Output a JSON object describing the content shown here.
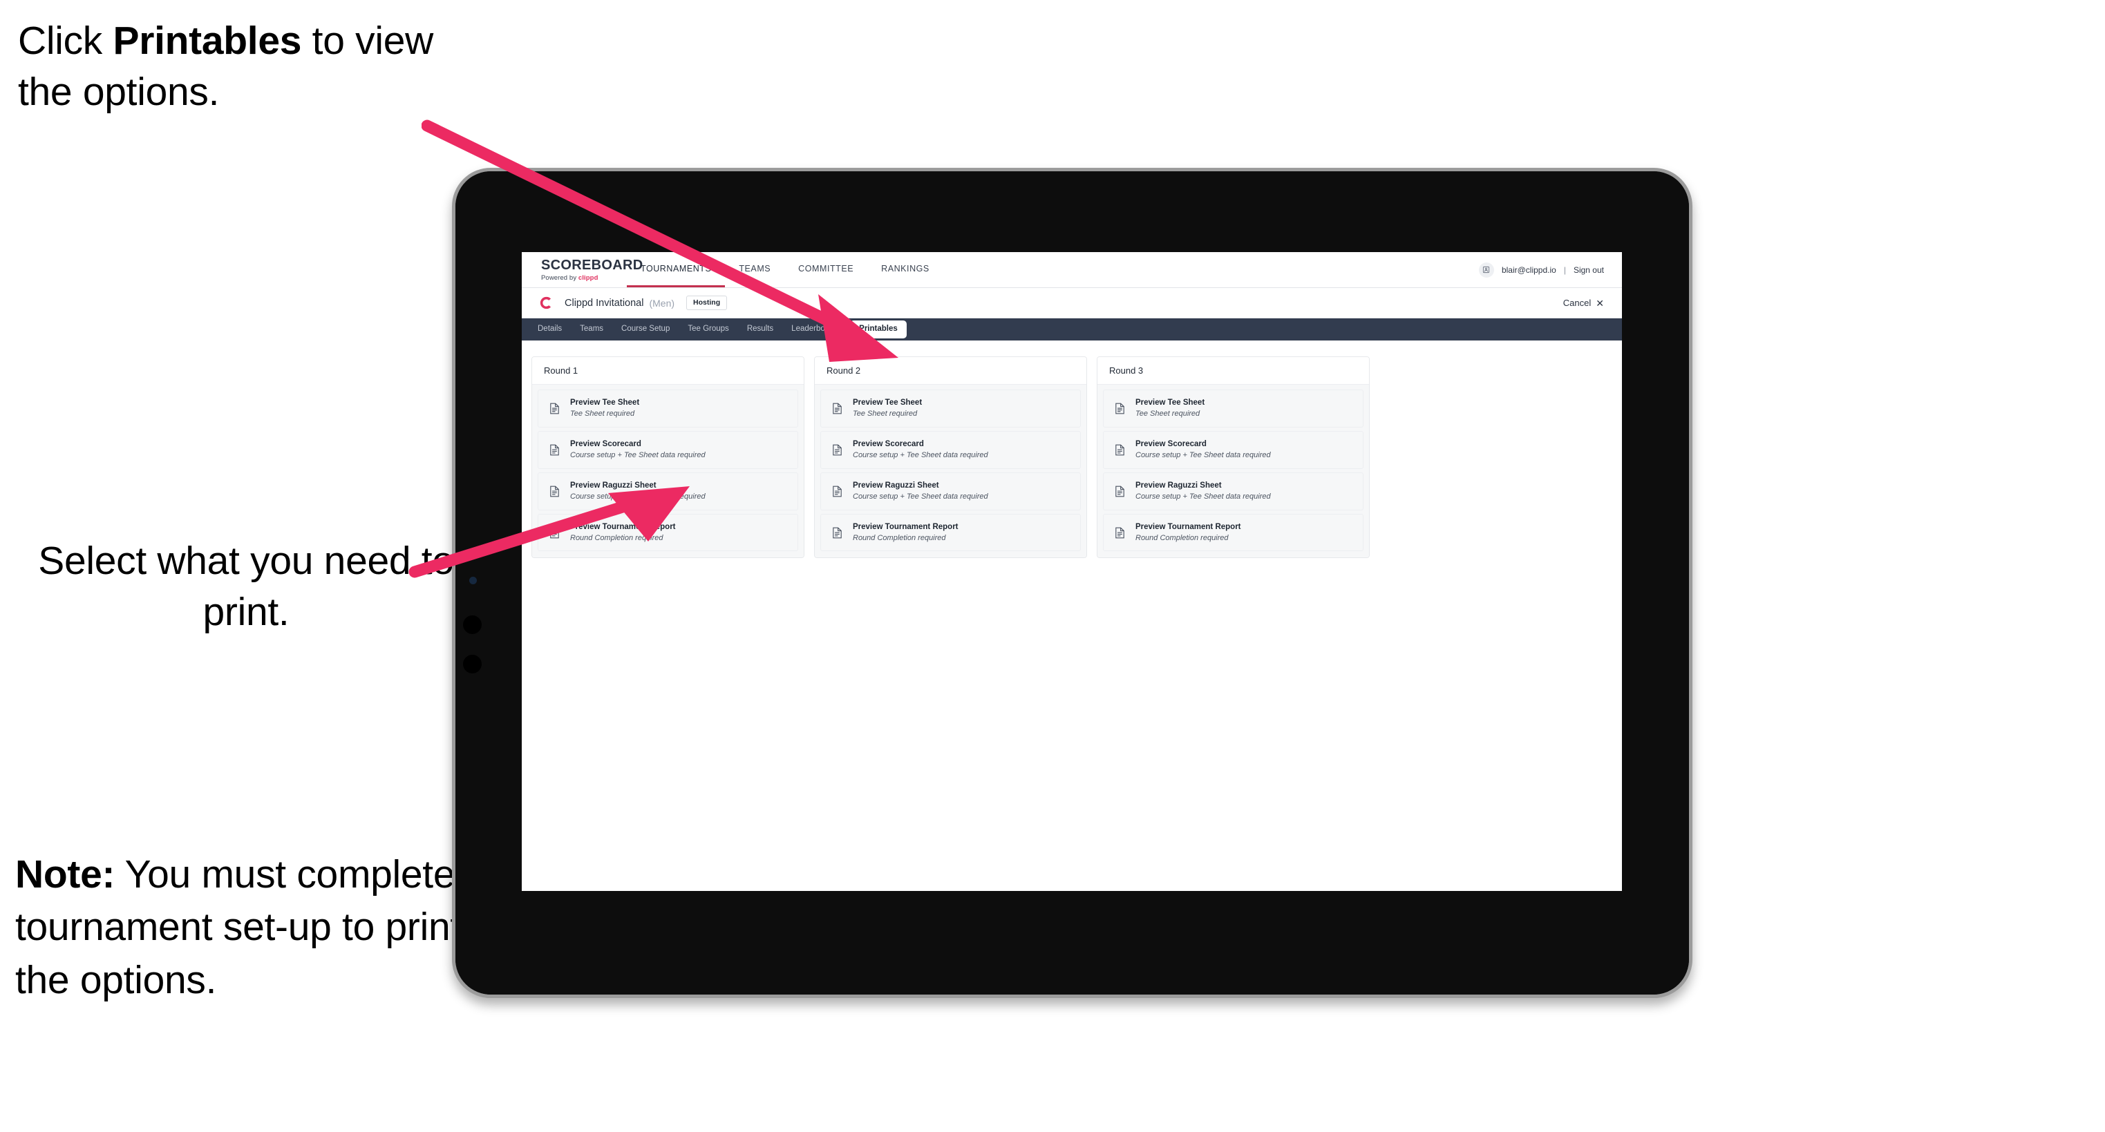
{
  "annotations": {
    "click_printables": {
      "prefix": "Click ",
      "bold": "Printables",
      "suffix": " to view the options."
    },
    "select_print": "Select what you need to print.",
    "note": {
      "bold": "Note:",
      "text": " You must complete the tournament set-up to print all the options."
    }
  },
  "accent_color": "#ec2a62",
  "app": {
    "brand": {
      "title": "SCOREBOARD",
      "powered_prefix": "Powered by ",
      "powered_name": "clippd"
    },
    "topnav": [
      {
        "label": "TOURNAMENTS",
        "active": true
      },
      {
        "label": "TEAMS",
        "active": false
      },
      {
        "label": "COMMITTEE",
        "active": false
      },
      {
        "label": "RANKINGS",
        "active": false
      }
    ],
    "account": {
      "email": "blair@clippd.io",
      "separator": "|",
      "sign_out": "Sign out"
    },
    "tournament": {
      "name": "Clippd Invitational",
      "gender": "(Men)",
      "status_badge": "Hosting",
      "cancel_label": "Cancel",
      "cancel_icon": "✕"
    },
    "tabs": [
      {
        "label": "Details",
        "active": false
      },
      {
        "label": "Teams",
        "active": false
      },
      {
        "label": "Course Setup",
        "active": false
      },
      {
        "label": "Tee Groups",
        "active": false
      },
      {
        "label": "Results",
        "active": false
      },
      {
        "label": "Leaderboards",
        "active": false
      },
      {
        "label": "Printables",
        "active": true
      }
    ],
    "rounds": [
      {
        "title": "Round 1",
        "items": [
          {
            "title": "Preview Tee Sheet",
            "sub": "Tee Sheet required"
          },
          {
            "title": "Preview Scorecard",
            "sub": "Course setup + Tee Sheet data required"
          },
          {
            "title": "Preview Raguzzi Sheet",
            "sub": "Course setup + Tee Sheet data required"
          },
          {
            "title": "Preview Tournament Report",
            "sub": "Round Completion required"
          }
        ]
      },
      {
        "title": "Round 2",
        "items": [
          {
            "title": "Preview Tee Sheet",
            "sub": "Tee Sheet required"
          },
          {
            "title": "Preview Scorecard",
            "sub": "Course setup + Tee Sheet data required"
          },
          {
            "title": "Preview Raguzzi Sheet",
            "sub": "Course setup + Tee Sheet data required"
          },
          {
            "title": "Preview Tournament Report",
            "sub": "Round Completion required"
          }
        ]
      },
      {
        "title": "Round 3",
        "items": [
          {
            "title": "Preview Tee Sheet",
            "sub": "Tee Sheet required"
          },
          {
            "title": "Preview Scorecard",
            "sub": "Course setup + Tee Sheet data required"
          },
          {
            "title": "Preview Raguzzi Sheet",
            "sub": "Course setup + Tee Sheet data required"
          },
          {
            "title": "Preview Tournament Report",
            "sub": "Round Completion required"
          }
        ]
      }
    ]
  }
}
